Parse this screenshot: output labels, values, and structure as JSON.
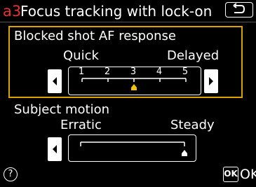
{
  "header": {
    "code": "a3",
    "title": "Focus tracking with lock-on",
    "back_icon": "return-arrow-icon"
  },
  "blocked_shot": {
    "title": "Blocked shot AF response",
    "left_label": "Quick",
    "right_label": "Delayed",
    "ticks": [
      "1",
      "2",
      "3",
      "4",
      "5"
    ],
    "selected_value": 3,
    "selector_color": "#f2c200"
  },
  "subject_motion": {
    "title": "Subject motion",
    "left_label": "Erratic",
    "right_label": "Steady",
    "selected_position": "right-end"
  },
  "footer": {
    "help_glyph": "?",
    "ok_badge": "OK",
    "ok_label": "OK"
  },
  "colors": {
    "accent_red": "#e8302e",
    "selection_border": "#d9a400",
    "background": "#000000"
  }
}
